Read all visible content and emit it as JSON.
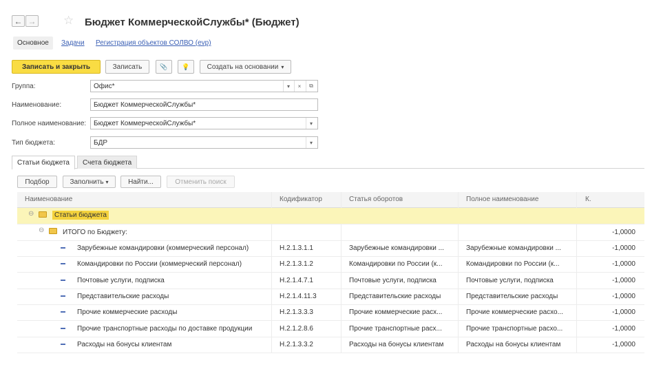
{
  "window": {
    "title": "Бюджет КоммерческойСлужбы* (Бюджет)",
    "back_icon": "←",
    "forward_icon": "→",
    "favorite_icon": "☆"
  },
  "nav": {
    "main": "Основное",
    "tasks": "Задачи",
    "registration": "Регистрация объектов СОЛВО (evp)"
  },
  "toolbar": {
    "save_close": "Записать и закрыть",
    "save": "Записать",
    "attach_icon": "📎",
    "bulb_icon": "💡",
    "create_based": "Создать на основании",
    "dropdown_arrow": "▾"
  },
  "form": {
    "group_label": "Группа:",
    "group_value": "Офис*",
    "name_label": "Наименование:",
    "name_value": "Бюджет КоммерческойСлужбы*",
    "full_name_label": "Полное наименование:",
    "full_name_value": "Бюджет КоммерческойСлужбы*",
    "budget_type_label": "Тип бюджета:",
    "budget_type_value": "БДР",
    "clear_icon": "×",
    "open_icon": "⧉"
  },
  "tabs": {
    "items": "Статьи бюджета",
    "accounts": "Счета бюджета"
  },
  "table_toolbar": {
    "select": "Подбор",
    "fill": "Заполнить",
    "find": "Найти...",
    "cancel_search": "Отменить поиск"
  },
  "table": {
    "columns": [
      "Наименование",
      "Кодификатор",
      "Статья оборотов",
      "Полное наименование",
      "К."
    ],
    "root": {
      "expander": "⊖",
      "name": "Статьи бюджета"
    },
    "group": {
      "expander": "⊖",
      "name": "ИТОГО по Бюджету:",
      "k": "-1,0000"
    },
    "rows": [
      {
        "name": "Зарубежные командировки (коммерческий персонал)",
        "code": "Н.2.1.3.1.1",
        "article": "Зарубежные командировки ...",
        "full": "Зарубежные командировки ...",
        "k": "-1,0000"
      },
      {
        "name": "Командировки по России (коммерческий персонал)",
        "code": "Н.2.1.3.1.2",
        "article": "Командировки по России (к...",
        "full": "Командировки по России (к...",
        "k": "-1,0000"
      },
      {
        "name": "Почтовые услуги, подписка",
        "code": "Н.2.1.4.7.1",
        "article": "Почтовые услуги, подписка",
        "full": "Почтовые услуги, подписка",
        "k": "-1,0000"
      },
      {
        "name": "Представительские расходы",
        "code": "Н.2.1.4.11.3",
        "article": "Представительские расходы",
        "full": "Представительские расходы",
        "k": "-1,0000"
      },
      {
        "name": "Прочие коммерческие расходы",
        "code": "Н.2.1.3.3.3",
        "article": "Прочие коммерческие расх...",
        "full": "Прочие коммерческие расхо...",
        "k": "-1,0000"
      },
      {
        "name": "Прочие транспортные расходы по доставке продукции",
        "code": "Н.2.1.2.8.6",
        "article": "Прочие транспортные расх...",
        "full": "Прочие транспортные расхо...",
        "k": "-1,0000"
      },
      {
        "name": "Расходы на бонусы клиентам",
        "code": "Н.2.1.3.3.2",
        "article": "Расходы на бонусы клиентам",
        "full": "Расходы на бонусы клиентам",
        "k": "-1,0000"
      }
    ]
  }
}
